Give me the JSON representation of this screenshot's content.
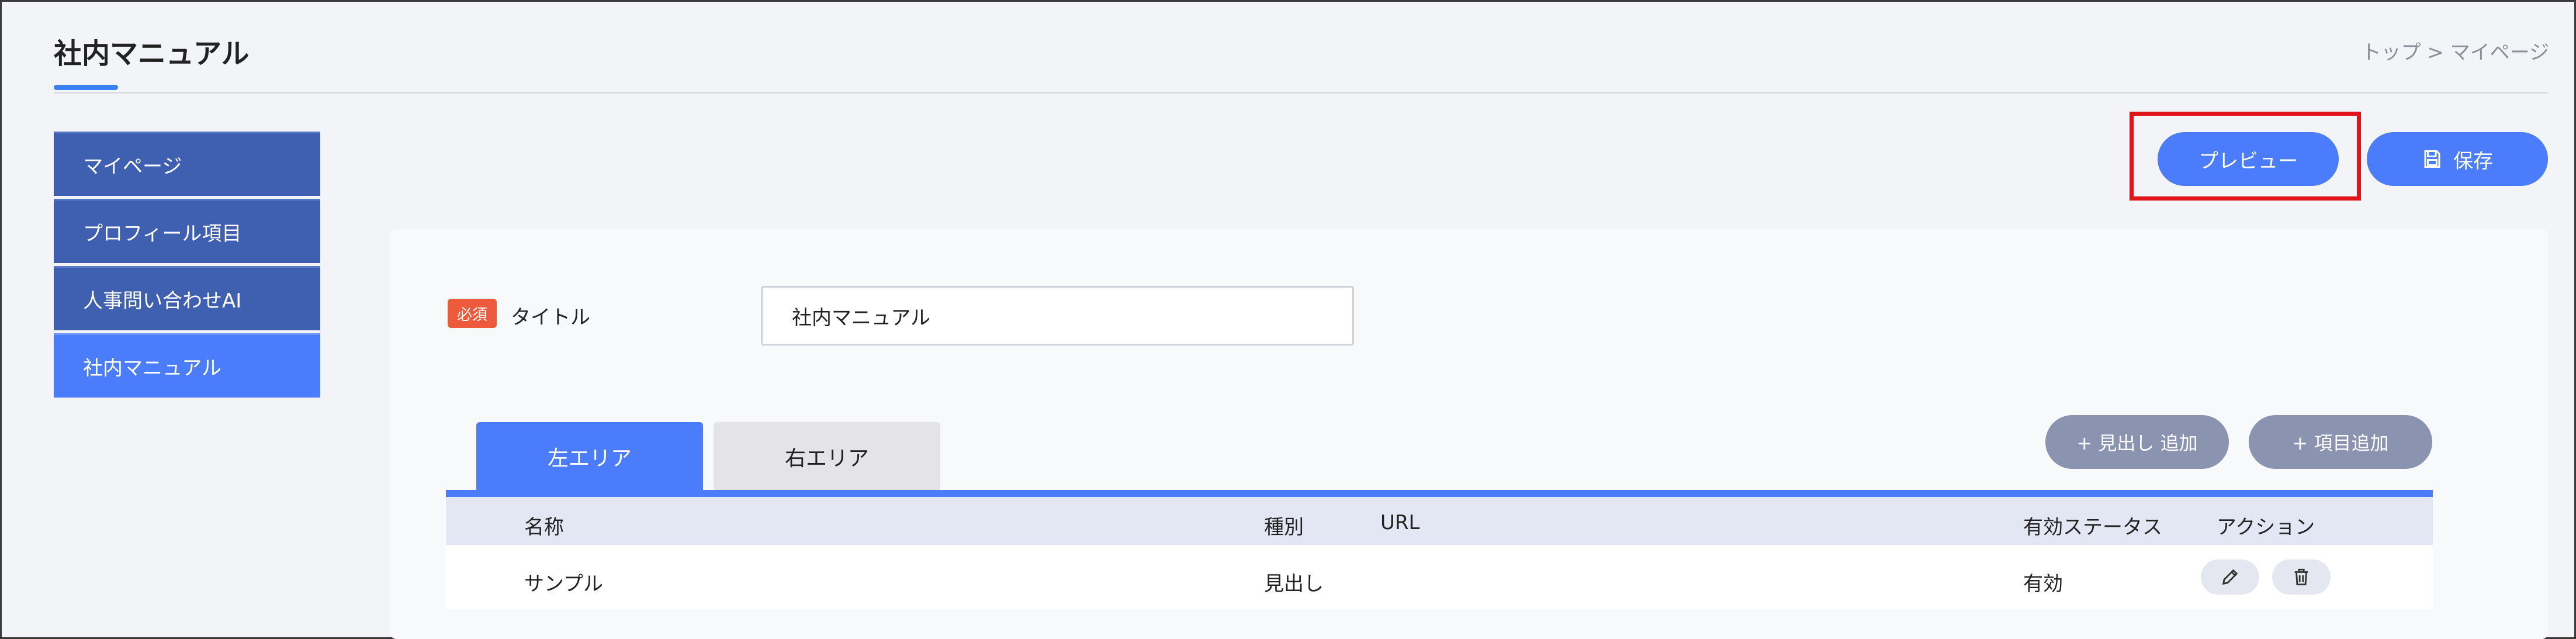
{
  "header": {
    "app_title": "社内マニュアル",
    "breadcrumb": "トップ > マイページ"
  },
  "sidebar": {
    "items": [
      {
        "label": "マイページ",
        "active": false
      },
      {
        "label": "プロフィール項目",
        "active": false
      },
      {
        "label": "人事問い合わせAI",
        "active": false
      },
      {
        "label": "社内マニュアル",
        "active": true
      }
    ]
  },
  "toolbar": {
    "preview_label": "プレビュー",
    "save_label": "保存",
    "save_icon": "save-icon"
  },
  "form": {
    "required_badge": "必須",
    "title_label": "タイトル",
    "title_value": "社内マニュアル"
  },
  "tabs": {
    "left": "左エリア",
    "right": "右エリア",
    "active": "left"
  },
  "actions": {
    "add_heading": "+ 見出し 追加",
    "add_item": "+ 項目追加"
  },
  "table": {
    "headers": {
      "name": "名称",
      "type": "種別",
      "url": "URL",
      "status": "有効ステータス",
      "action": "アクション"
    },
    "rows": [
      {
        "name": "サンプル",
        "type": "見出し",
        "url": "",
        "status": "有効"
      }
    ]
  },
  "colors": {
    "accent": "#4a7cfb",
    "sidebar": "#3f5fb0",
    "highlight": "#e0151b",
    "required": "#ee5a3c",
    "secondary_button": "#8a94b0"
  }
}
